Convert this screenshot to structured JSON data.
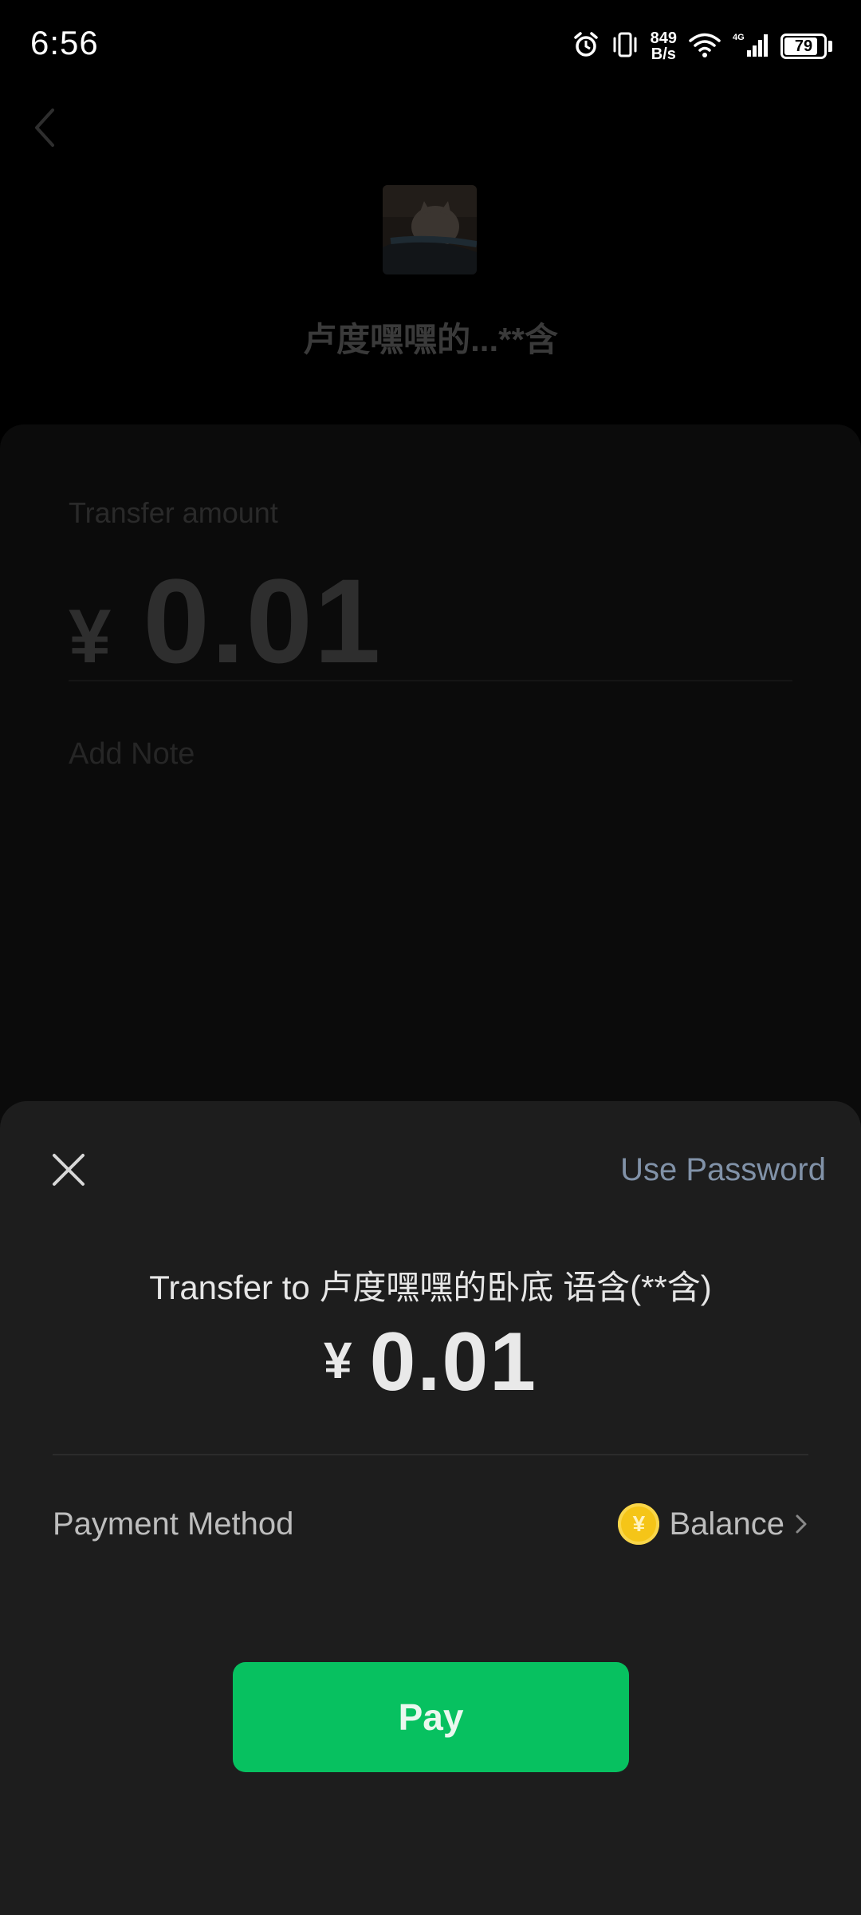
{
  "status_bar": {
    "time": "6:56",
    "net_speed_value": "849",
    "net_speed_unit": "B/s",
    "battery": "79",
    "icons": [
      "alarm-icon",
      "vibrate-icon",
      "wifi-icon",
      "signal-4g-icon"
    ]
  },
  "background": {
    "recipient_name": "卢度嘿嘿的...**含",
    "transfer_label": "Transfer amount",
    "currency": "¥",
    "amount": "0.01",
    "note_placeholder": "Add Note"
  },
  "sheet": {
    "use_password": "Use Password",
    "transfer_to": "Transfer to 卢度嘿嘿的卧底 语含(**含)",
    "currency": "¥",
    "amount": "0.01",
    "payment_method_label": "Payment Method",
    "payment_method_value": "Balance",
    "payment_icon": "yuan-coin-icon",
    "pay_label": "Pay"
  },
  "colors": {
    "accent_green": "#07c160",
    "link_blue_gray": "#8192a8",
    "coin_yellow": "#f5c518"
  }
}
